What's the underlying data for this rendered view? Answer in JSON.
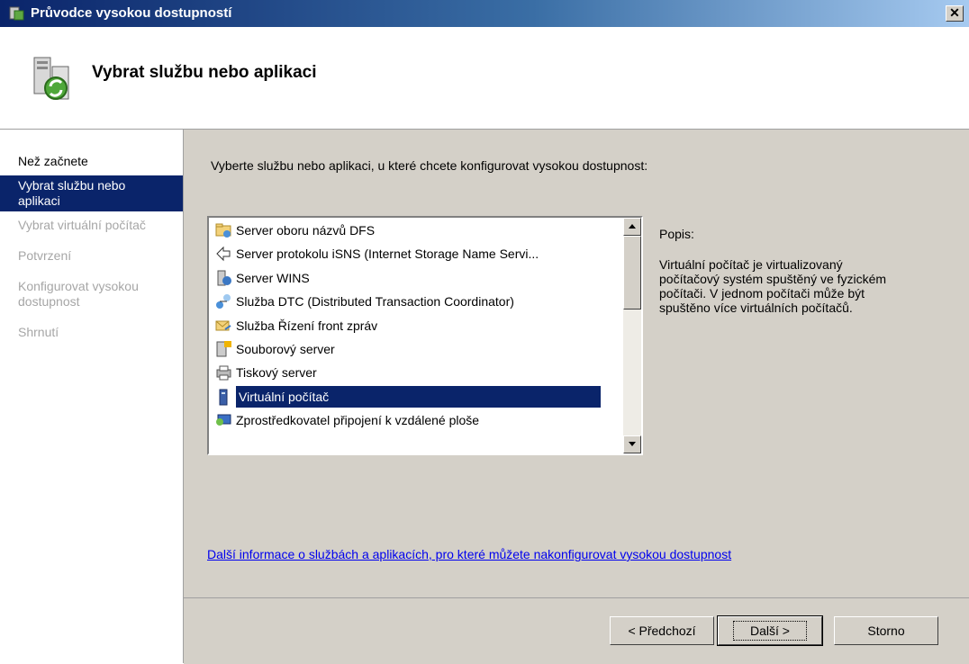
{
  "window": {
    "title": "Průvodce vysokou dostupností",
    "close_label": "✕"
  },
  "header": {
    "title": "Vybrat službu nebo aplikaci"
  },
  "sidebar": {
    "steps": [
      {
        "label": "Než začnete",
        "state": "done"
      },
      {
        "label": "Vybrat službu nebo aplikaci",
        "state": "active"
      },
      {
        "label": "Vybrat virtuální počítač",
        "state": "disabled"
      },
      {
        "label": "Potvrzení",
        "state": "disabled"
      },
      {
        "label": "Konfigurovat vysokou dostupnost",
        "state": "disabled"
      },
      {
        "label": "Shrnutí",
        "state": "disabled"
      }
    ]
  },
  "main": {
    "instruction": "Vyberte službu nebo aplikaci, u které chcete konfigurovat vysokou dostupnost:",
    "list_items": [
      {
        "label": "Server oboru názvů DFS",
        "icon": "folder-network-icon"
      },
      {
        "label": "Server protokolu iSNS (Internet Storage Name Servi...",
        "icon": "network-arrow-icon"
      },
      {
        "label": "Server WINS",
        "icon": "server-wins-icon"
      },
      {
        "label": "Služba DTC (Distributed Transaction Coordinator)",
        "icon": "transaction-icon"
      },
      {
        "label": "Služba Řízení front zpráv",
        "icon": "message-queue-icon"
      },
      {
        "label": "Souborový server",
        "icon": "file-server-icon"
      },
      {
        "label": "Tiskový server",
        "icon": "printer-icon"
      },
      {
        "label": "Virtuální počítač",
        "icon": "virtual-machine-icon",
        "selected": true
      },
      {
        "label": "Zprostředkovatel připojení k vzdálené ploše",
        "icon": "remote-desktop-icon"
      }
    ],
    "description_label": "Popis:",
    "description_text": "Virtuální počítač je virtualizovaný počítačový systém spuštěný ve fyzickém počítači. V jednom počítači může být spuštěno více virtuálních počítačů.",
    "link_text": "Další informace o službách a aplikacích, pro které můžete nakonfigurovat vysokou dostupnost"
  },
  "footer": {
    "prev_label": "< Předchozí",
    "next_label": "Další >",
    "cancel_label": "Storno"
  }
}
